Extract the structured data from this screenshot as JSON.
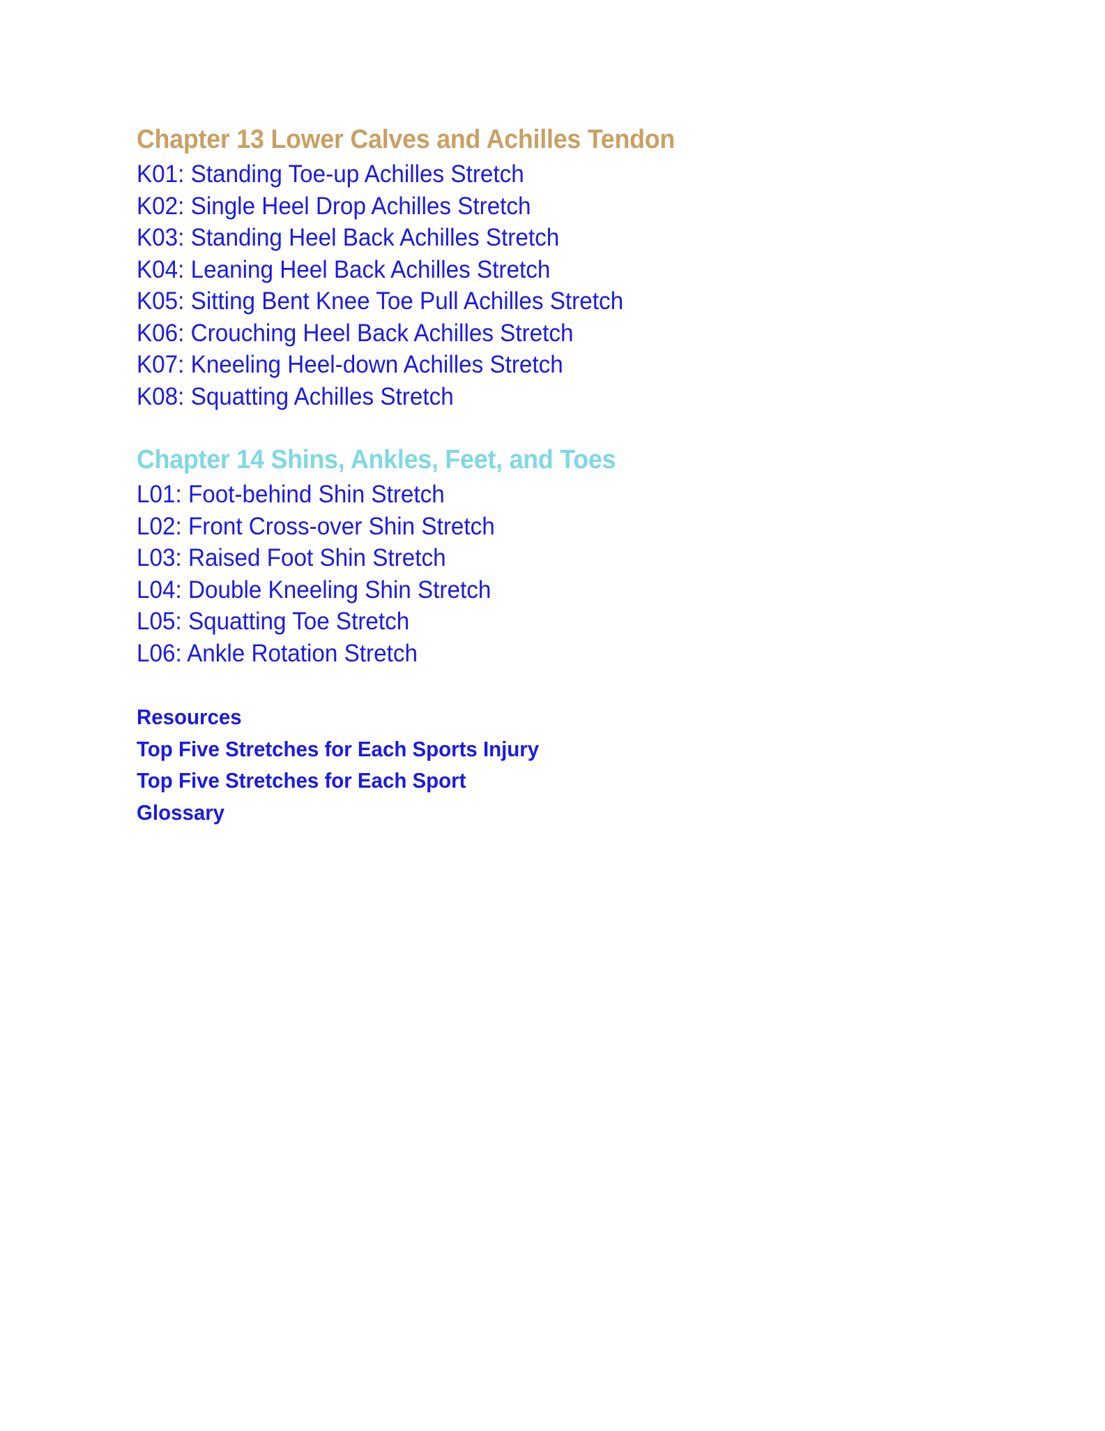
{
  "page": {
    "background_color": "#ffffff",
    "text_colors": {
      "chapter13_heading": "#c9a063",
      "chapter14_heading": "#7fd8e2",
      "list_item": "#1a1ae6",
      "resources": "#1a1ae6"
    }
  },
  "sections": [
    {
      "id": "chapter-13",
      "heading": "Chapter 13 Lower Calves and Achilles Tendon",
      "heading_color": "#c9a063",
      "items": [
        "K01: Standing Toe-up Achilles Stretch",
        "K02: Single Heel Drop Achilles Stretch",
        "K03: Standing Heel Back Achilles Stretch",
        "K04: Leaning Heel Back Achilles Stretch",
        "K05: Sitting Bent Knee Toe Pull Achilles Stretch",
        "K06: Crouching Heel Back Achilles Stretch",
        "K07: Kneeling Heel-down Achilles Stretch",
        "K08: Squatting Achilles Stretch"
      ]
    },
    {
      "id": "chapter-14",
      "heading": "Chapter 14 Shins, Ankles, Feet, and Toes",
      "heading_color": "#7fd8e2",
      "items": [
        "L01: Foot-behind Shin Stretch",
        "L02: Front Cross-over Shin Stretch",
        "L03: Raised Foot Shin Stretch",
        "L04: Double Kneeling Shin Stretch",
        "L05: Squatting Toe Stretch",
        "L06: Ankle Rotation Stretch"
      ]
    }
  ],
  "resources": {
    "lines": [
      "Resources",
      "Top Five Stretches for Each Sports Injury",
      "Top Five Stretches for Each Sport",
      "Glossary"
    ]
  }
}
